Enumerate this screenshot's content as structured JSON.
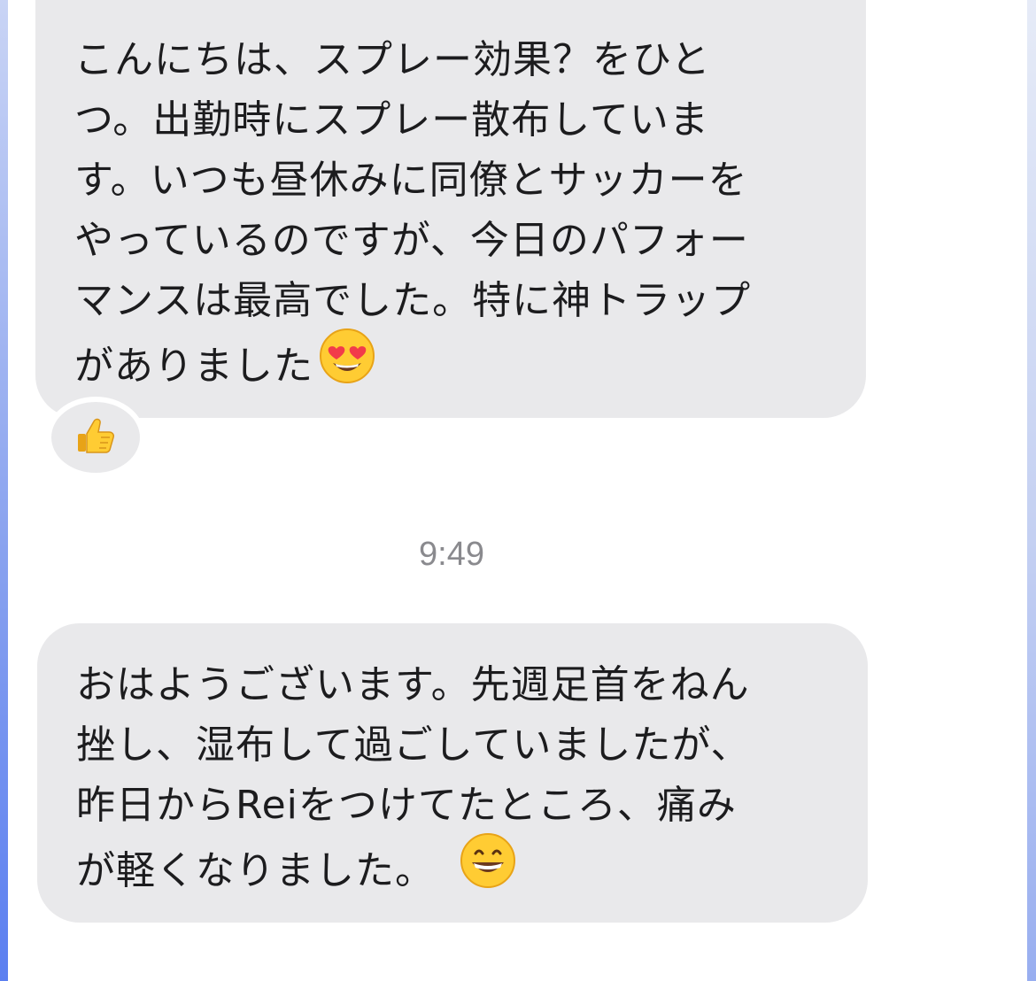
{
  "messages": [
    {
      "lines": [
        "こんにちは、スプレー効果？をひと",
        "つ。出勤時にスプレー散布していま",
        "す。いつも昼休みに同僚とサッカーを",
        "やっているのですが、今日のパフォー",
        "マンスは最高でした。特に神トラップ",
        "がありました"
      ],
      "emoji": "heart-eyes-emoji",
      "reaction": "thumbs-up-icon"
    },
    {
      "lines": [
        "おはようございます。先週足首をねん",
        "挫し、湿布して過ごしていましたが、",
        "昨日からReiをつけてたところ、痛み",
        "が軽くなりました。"
      ],
      "emoji": "grinning-emoji"
    }
  ],
  "timestamp": "9:49",
  "colors": {
    "bubble": "#e9e9eb",
    "text": "#1c1c1e",
    "timestamp": "#8a8a8e",
    "emoji_yellow": "#ffcc33",
    "heart_red": "#f23b4a"
  }
}
